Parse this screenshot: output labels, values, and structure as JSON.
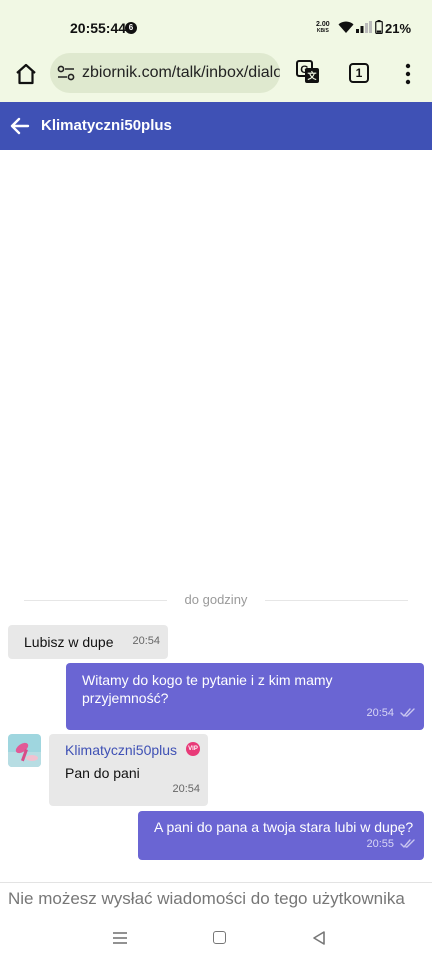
{
  "status_bar": {
    "time": "20:55:44",
    "notification_count": "6",
    "net_speed_value": "2.00",
    "net_speed_unit": "KB/S",
    "battery_percent": "21%"
  },
  "browser": {
    "url": "zbiornik.com/talk/inbox/dialog",
    "tab_count": "1",
    "icons": [
      "home-icon",
      "site-settings-icon",
      "translate-icon",
      "tabs-icon",
      "more-vert-icon"
    ]
  },
  "header": {
    "title": "Klimatyczni50plus"
  },
  "chat": {
    "divider_label": "do godziny",
    "messages": [
      {
        "direction": "in",
        "text": "Lubisz w dupe",
        "time": "20:54"
      },
      {
        "direction": "out",
        "text": "Witamy do kogo te pytanie i z kim mamy przyjemność?",
        "time": "20:54",
        "read": true
      },
      {
        "direction": "in",
        "sender": "Klimatyczni50plus",
        "badge": "VIP",
        "text": "Pan do pani",
        "time": "20:54"
      },
      {
        "direction": "out",
        "text": "A pani do pana a twoja stara lubi w dupę?",
        "time": "20:55",
        "read": true
      }
    ]
  },
  "composer": {
    "notice": "Nie możesz wysłać wiadomości do tego użytkownika"
  },
  "colors": {
    "header": "#3f51b5",
    "outgoing_bubble": "#6a65d3",
    "incoming_bubble": "#e8e8e8",
    "browser_chrome": "#f1f8e4",
    "vip_badge": "#e83a78"
  }
}
